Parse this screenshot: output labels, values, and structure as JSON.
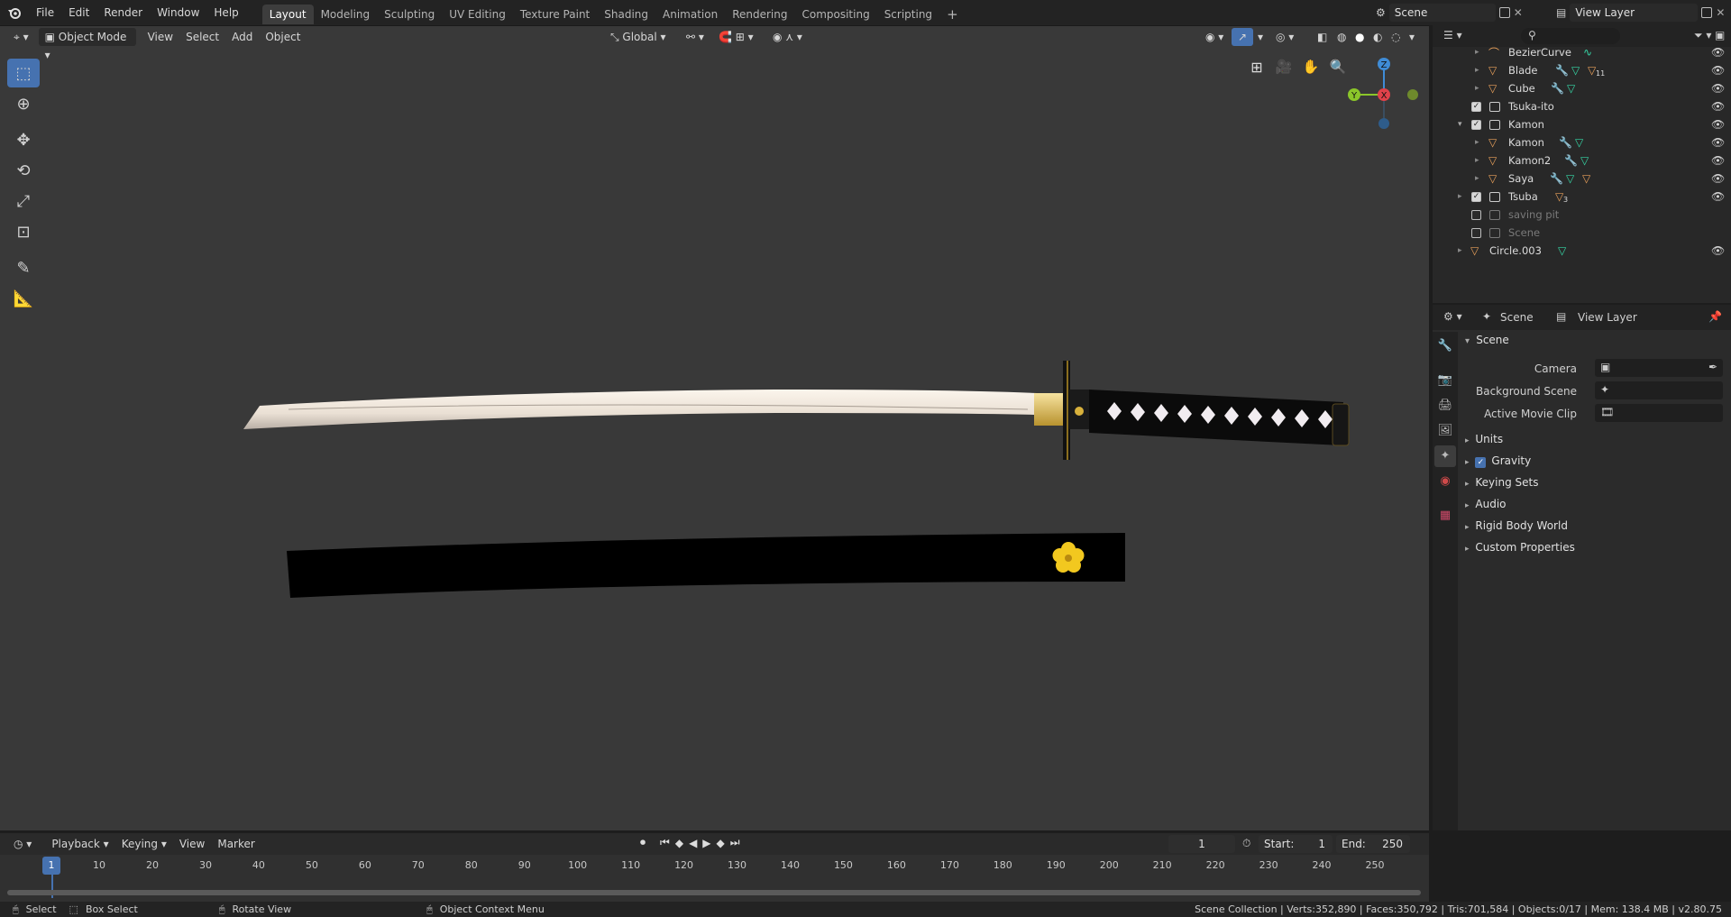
{
  "topbar": {
    "menus": [
      "File",
      "Edit",
      "Render",
      "Window",
      "Help"
    ],
    "workspaces": [
      "Layout",
      "Modeling",
      "Sculpting",
      "UV Editing",
      "Texture Paint",
      "Shading",
      "Animation",
      "Rendering",
      "Compositing",
      "Scripting"
    ],
    "active_workspace": "Layout",
    "add_tab": "+",
    "scene_value": "Scene",
    "view_layer_value": "View Layer"
  },
  "viewport_header": {
    "mode": "Object Mode",
    "menus": [
      "View",
      "Select",
      "Add",
      "Object"
    ],
    "transform": "Global"
  },
  "gizmo": {
    "z": "Z",
    "y": "Y",
    "x": "X"
  },
  "outliner": {
    "rows": [
      {
        "name": "BezierCurve",
        "kind": "object",
        "dim": false,
        "icons": [
          "curve"
        ]
      },
      {
        "name": "Blade",
        "kind": "object",
        "dim": false,
        "icons": [
          "mod",
          "mesh",
          "obj"
        ],
        "badge": "11"
      },
      {
        "name": "Cube",
        "kind": "object",
        "dim": false,
        "icons": [
          "mod",
          "mesh"
        ]
      },
      {
        "name": "Tsuka-ito",
        "kind": "collection",
        "dim": false,
        "checked": true
      },
      {
        "name": "Kamon",
        "kind": "collection",
        "dim": false,
        "checked": true
      },
      {
        "name": "Kamon",
        "kind": "object",
        "dim": false,
        "icons": [
          "mod",
          "mesh"
        ]
      },
      {
        "name": "Kamon2",
        "kind": "object",
        "dim": false,
        "icons": [
          "mod",
          "mesh"
        ]
      },
      {
        "name": "Saya",
        "kind": "object",
        "dim": false,
        "icons": [
          "mod",
          "mesh",
          "obj"
        ]
      },
      {
        "name": "Tsuba",
        "kind": "collection",
        "dim": false,
        "checked": true,
        "badge": "3"
      },
      {
        "name": "saving pit",
        "kind": "collection",
        "dim": true,
        "checked": false
      },
      {
        "name": "Scene",
        "kind": "collection",
        "dim": true,
        "checked": false
      },
      {
        "name": "Circle.003",
        "kind": "root-object",
        "dim": false,
        "icons": [
          "mesh"
        ]
      }
    ]
  },
  "properties": {
    "scene_label": "Scene",
    "view_layer_label": "View Layer",
    "section_title": "Scene",
    "camera_label": "Camera",
    "background_scene_label": "Background Scene",
    "active_movie_clip_label": "Active Movie Clip",
    "subsections": [
      "Units",
      "Gravity",
      "Keying Sets",
      "Audio",
      "Rigid Body World",
      "Custom Properties"
    ],
    "gravity_checked": true
  },
  "timeline": {
    "menus": [
      "Playback",
      "Keying",
      "View",
      "Marker"
    ],
    "current_frame": "1",
    "start_label": "Start:",
    "start_value": "1",
    "end_label": "End:",
    "end_value": "250",
    "ruler": [
      "1",
      "10",
      "20",
      "30",
      "40",
      "50",
      "60",
      "70",
      "80",
      "90",
      "100",
      "110",
      "120",
      "130",
      "140",
      "150",
      "160",
      "170",
      "180",
      "190",
      "200",
      "210",
      "220",
      "230",
      "240",
      "250"
    ]
  },
  "status": {
    "select": "Select",
    "box_select": "Box Select",
    "rotate_view": "Rotate View",
    "context_menu": "Object Context Menu",
    "stats": "Scene Collection | Verts:352,890 | Faces:350,792 | Tris:701,584 | Objects:0/17 | Mem: 138.4 MB | v2.80.75"
  },
  "colors": {
    "accent": "#4672b0",
    "object_icon": "#e8a05a",
    "mesh_icon": "#36d6a6",
    "modifier_icon": "#6aa6ff",
    "gizmo_x": "#e0424a",
    "gizmo_y": "#8bc62a",
    "gizmo_z": "#3f8cd6"
  }
}
